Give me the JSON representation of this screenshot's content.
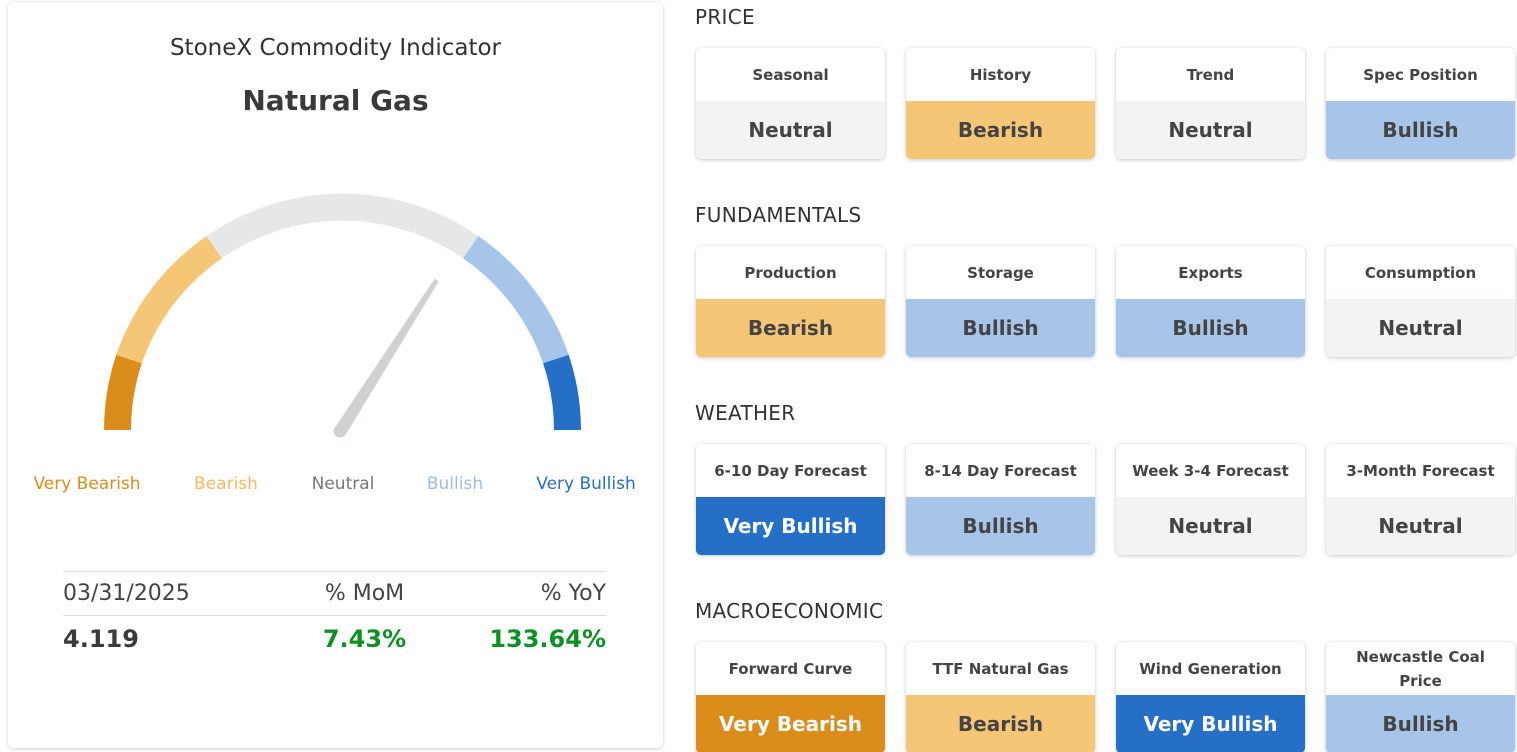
{
  "colors": {
    "very_bearish": "#da8d1a",
    "bearish": "#f6c677",
    "neutral": "#f2f3f3",
    "bullish": "#a7c5e8",
    "very_bullish": "#2570c6",
    "neutral_label": "#777777",
    "bearish_label": "#f5b85a",
    "bullish_label": "#9dbde2",
    "needle": "#cfd2d2",
    "positive_change": "#0c9222"
  },
  "indicator": {
    "title": "StoneX Commodity Indicator",
    "commodity": "Natural Gas"
  },
  "gauge": {
    "labels": [
      "Very Bearish",
      "Bearish",
      "Neutral",
      "Bullish",
      "Very Bullish"
    ]
  },
  "stats": {
    "date": "03/31/2025",
    "mom_label": "% MoM",
    "yoy_label": "% YoY",
    "price": "4.119",
    "mom": "7.43%",
    "yoy": "133.64%"
  },
  "sections": [
    {
      "title": "PRICE",
      "tiles": [
        {
          "label": "Seasonal",
          "value": "Neutral",
          "state": "neutral"
        },
        {
          "label": "History",
          "value": "Bearish",
          "state": "bearish"
        },
        {
          "label": "Trend",
          "value": "Neutral",
          "state": "neutral"
        },
        {
          "label": "Spec Position",
          "value": "Bullish",
          "state": "bullish"
        }
      ]
    },
    {
      "title": "FUNDAMENTALS",
      "tiles": [
        {
          "label": "Production",
          "value": "Bearish",
          "state": "bearish"
        },
        {
          "label": "Storage",
          "value": "Bullish",
          "state": "bullish"
        },
        {
          "label": "Exports",
          "value": "Bullish",
          "state": "bullish"
        },
        {
          "label": "Consumption",
          "value": "Neutral",
          "state": "neutral"
        }
      ]
    },
    {
      "title": "WEATHER",
      "tiles": [
        {
          "label": "6-10 Day Forecast",
          "value": "Very Bullish",
          "state": "very_bullish"
        },
        {
          "label": "8-14 Day Forecast",
          "value": "Bullish",
          "state": "bullish"
        },
        {
          "label": "Week 3-4 Forecast",
          "value": "Neutral",
          "state": "neutral"
        },
        {
          "label": "3-Month Forecast",
          "value": "Neutral",
          "state": "neutral"
        }
      ]
    },
    {
      "title": "MACROECONOMIC",
      "tiles": [
        {
          "label": "Forward Curve",
          "value": "Very Bearish",
          "state": "very_bearish"
        },
        {
          "label": "TTF Natural Gas",
          "value": "Bearish",
          "state": "bearish"
        },
        {
          "label": "Wind Generation",
          "value": "Very Bullish",
          "state": "very_bullish"
        },
        {
          "label": "Newcastle Coal Price",
          "value": "Bullish",
          "state": "bullish"
        }
      ]
    }
  ]
}
